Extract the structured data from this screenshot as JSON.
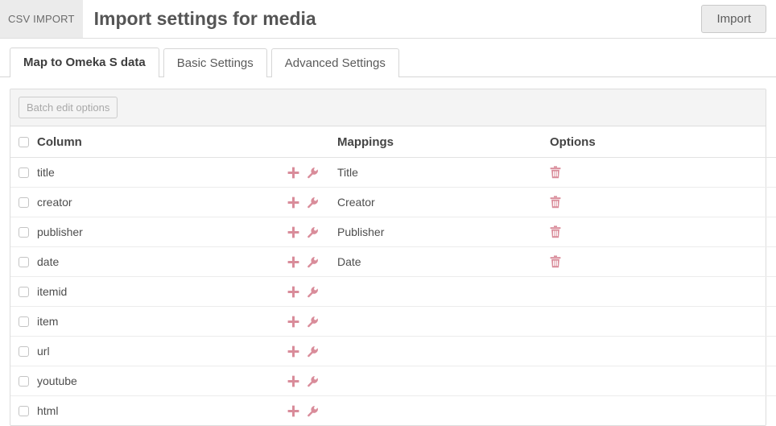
{
  "header": {
    "badge": "CSV IMPORT",
    "title": "Import settings for media",
    "import_label": "Import"
  },
  "tabs": [
    {
      "label": "Map to Omeka S data",
      "active": true
    },
    {
      "label": "Basic Settings",
      "active": false
    },
    {
      "label": "Advanced Settings",
      "active": false
    }
  ],
  "toolbar": {
    "batch_edit_label": "Batch edit options"
  },
  "table": {
    "headers": {
      "column": "Column",
      "mappings": "Mappings",
      "options": "Options"
    },
    "rows": [
      {
        "column": "title",
        "mapping": "Title",
        "has_delete": true
      },
      {
        "column": "creator",
        "mapping": "Creator",
        "has_delete": true
      },
      {
        "column": "publisher",
        "mapping": "Publisher",
        "has_delete": true
      },
      {
        "column": "date",
        "mapping": "Date",
        "has_delete": true
      },
      {
        "column": "itemid",
        "mapping": "",
        "has_delete": false
      },
      {
        "column": "item",
        "mapping": "",
        "has_delete": false
      },
      {
        "column": "url",
        "mapping": "",
        "has_delete": false
      },
      {
        "column": "youtube",
        "mapping": "",
        "has_delete": false
      },
      {
        "column": "html",
        "mapping": "",
        "has_delete": false
      }
    ]
  },
  "icons": {
    "add": "plus-icon",
    "settings": "wrench-icon",
    "delete": "trash-icon"
  },
  "colors": {
    "accent": "#d98c9a",
    "badge_bg": "#ebebeb",
    "header_band": "#f4f4f4",
    "border": "#dddddd",
    "title_text": "#555555"
  }
}
